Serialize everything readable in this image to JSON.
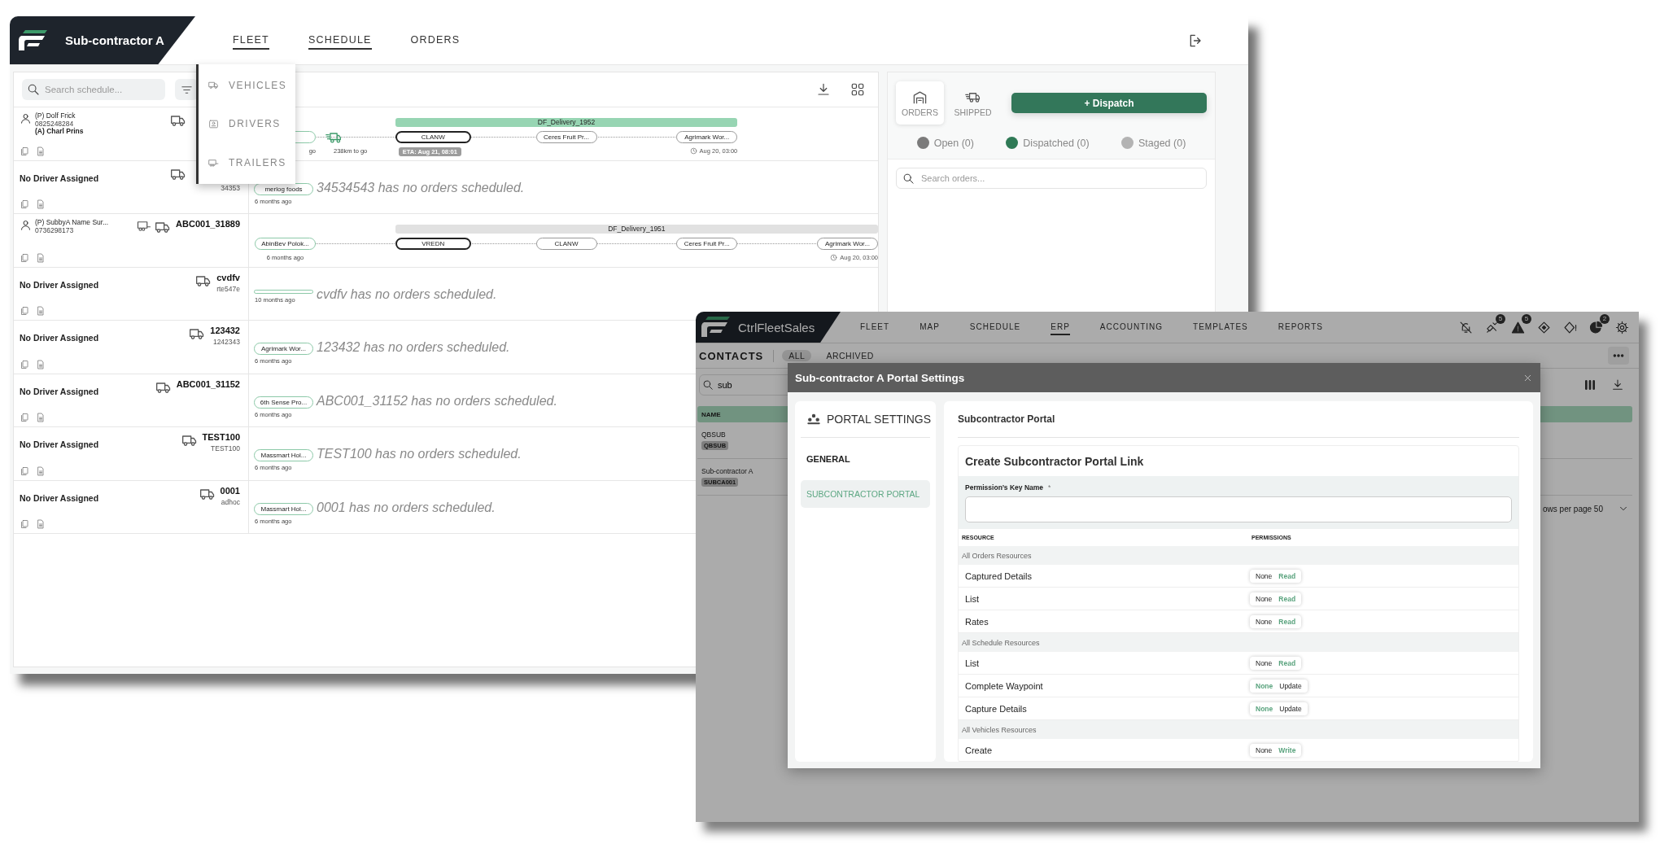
{
  "fleet_window": {
    "brand": "Sub-contractor A",
    "nav": [
      {
        "label": "FLEET",
        "selected": true
      },
      {
        "label": "SCHEDULE",
        "selected": true
      },
      {
        "label": "ORDERS",
        "selected": false
      }
    ],
    "fleet_menu": {
      "expanded": true,
      "items": [
        {
          "label": "VEHICLES",
          "kind": "vehicle"
        },
        {
          "label": "DRIVERS",
          "kind": "driver"
        },
        {
          "label": "TRAILERS",
          "kind": "trailer"
        }
      ]
    },
    "search": {
      "placeholder": "Search schedule..."
    },
    "rows": [
      {
        "driver": {
          "kind": "person",
          "lines": [
            "(P) Dolf Frick",
            "0825248284",
            "(A) Charl Prins"
          ]
        },
        "trailer": false,
        "timeline": {
          "kind": "trip",
          "trip": "DF_Delivery_1952",
          "active": true,
          "origin": {
            "time": "go"
          },
          "progress": "238km to go",
          "stops": [
            {
              "label": "CLANW",
              "current": true,
              "eta": "ETA: Aug 21, 08:01"
            },
            {
              "label": "Ceres Fruit Pr...",
              "current": false
            },
            {
              "label": "Agrimark Wor...",
              "current": false,
              "due": "Aug 20, 03:00"
            }
          ]
        }
      },
      {
        "driver": {
          "kind": "none",
          "label": "No Driver Assigned"
        },
        "trailer": false,
        "vehicle": {
          "reg": "34353"
        },
        "timeline": {
          "kind": "empty",
          "origin": {
            "label": "merlog foods",
            "time": "6 months ago"
          },
          "message": "34534543 has no orders scheduled."
        }
      },
      {
        "driver": {
          "kind": "person",
          "lines": [
            "(P) SubbyA Name Sur...",
            "0736298173"
          ]
        },
        "trailer": true,
        "vehicle": {
          "name": "ABC001_31889"
        },
        "timeline": {
          "kind": "trip",
          "trip": "DF_Delivery_1951",
          "active": false,
          "origin": {
            "label": "AbinBev Polok...",
            "time": "6 months ago"
          },
          "stops": [
            {
              "label": "VREDN",
              "current": true
            },
            {
              "label": "CLANW",
              "current": false
            },
            {
              "label": "Ceres Fruit Pr...",
              "current": false
            },
            {
              "label": "Agrimark Wor...",
              "current": false,
              "due": "Aug 20, 03:00"
            }
          ]
        }
      },
      {
        "driver": {
          "kind": "none",
          "label": "No Driver Assigned"
        },
        "trailer": false,
        "vehicle": {
          "name": "cvdfv",
          "reg": "rte547e"
        },
        "timeline": {
          "kind": "empty",
          "origin": {
            "time": "10 months ago"
          },
          "message": "cvdfv has no orders scheduled."
        }
      },
      {
        "driver": {
          "kind": "none",
          "label": "No Driver Assigned"
        },
        "trailer": false,
        "vehicle": {
          "name": "123432",
          "reg": "1242343"
        },
        "timeline": {
          "kind": "empty",
          "origin": {
            "label": "Agrimark Wor...",
            "time": "6 months ago"
          },
          "message": "123432 has no orders scheduled."
        }
      },
      {
        "driver": {
          "kind": "none",
          "label": "No Driver Assigned"
        },
        "trailer": false,
        "vehicle": {
          "name": "ABC001_31152"
        },
        "timeline": {
          "kind": "empty",
          "origin": {
            "label": "6th Sense Pro...",
            "time": "6 months ago"
          },
          "message": "ABC001_31152 has no orders scheduled."
        }
      },
      {
        "driver": {
          "kind": "none",
          "label": "No Driver Assigned"
        },
        "trailer": false,
        "vehicle": {
          "name": "TEST100",
          "reg": "TEST100"
        },
        "timeline": {
          "kind": "empty",
          "origin": {
            "label": "Massmart Hol...",
            "time": "6 months ago"
          },
          "message": "TEST100 has no orders scheduled."
        }
      },
      {
        "driver": {
          "kind": "none",
          "label": "No Driver Assigned"
        },
        "trailer": false,
        "vehicle": {
          "name": "0001",
          "reg": "adhoc"
        },
        "timeline": {
          "kind": "empty",
          "origin": {
            "label": "Massmart Hol...",
            "time": "6 months ago"
          },
          "message": "0001 has no orders scheduled."
        }
      }
    ],
    "orders_panel": {
      "tabs": [
        {
          "label": "ORDERS",
          "kind": "orders",
          "selected": true
        },
        {
          "label": "SHIPPED",
          "kind": "shipped",
          "selected": false
        }
      ],
      "dispatch_button": "+ Dispatch",
      "statuses": [
        {
          "label": "Open (0)",
          "color": "#7b7b7b"
        },
        {
          "label": "Dispatched (0)",
          "color": "#2f7a56"
        },
        {
          "label": "Staged (0)",
          "color": "#b3b3b3"
        }
      ],
      "search": {
        "placeholder": "Search orders..."
      }
    }
  },
  "erp_window": {
    "brand": "CtrlFleetSales",
    "nav": [
      {
        "label": "FLEET",
        "selected": false
      },
      {
        "label": "MAP",
        "selected": false
      },
      {
        "label": "SCHEDULE",
        "selected": false
      },
      {
        "label": "ERP",
        "selected": true
      },
      {
        "label": "ACCOUNTING",
        "selected": false
      },
      {
        "label": "TEMPLATES",
        "selected": false
      },
      {
        "label": "REPORTS",
        "selected": false
      }
    ],
    "alerts": [
      {
        "kind": "bell-off"
      },
      {
        "kind": "satellite",
        "count": "5"
      },
      {
        "kind": "warning",
        "count": "5"
      },
      {
        "kind": "diamond"
      },
      {
        "kind": "diamond-alert"
      },
      {
        "kind": "pie",
        "count": "2"
      },
      {
        "kind": "settings"
      }
    ],
    "page_title": "CONTACTS",
    "filters": [
      {
        "label": "ALL",
        "selected": true
      },
      {
        "label": "ARCHIVED",
        "selected": false
      }
    ],
    "search": {
      "value": "sub"
    },
    "table": {
      "columns": [
        "NAME"
      ],
      "rows": [
        {
          "name": "QBSUB",
          "code": "QBSUB"
        },
        {
          "name": "Sub-contractor A",
          "code": "SUBCA001"
        }
      ]
    },
    "pagination": "ows per page 50"
  },
  "portal_modal": {
    "title": "Sub-contractor A Portal Settings",
    "menu_title": "PORTAL SETTINGS",
    "menu": [
      {
        "label": "GENERAL",
        "selected": false
      },
      {
        "label": "SUBCONTRACTOR PORTAL",
        "selected": true
      }
    ],
    "section_title": "Subcontractor Portal",
    "form": {
      "title": "Create Subcontractor Portal Link",
      "field_label": "Permission’s Key Name",
      "required_mark": "*",
      "columns": [
        "RESOURCE",
        "PERMISSIONS"
      ],
      "groups": [
        {
          "name": "All Orders Resources",
          "rows": [
            {
              "resource": "Captured Details",
              "options": [
                {
                  "label": "None",
                  "selected": false
                },
                {
                  "label": "Read",
                  "selected": true
                }
              ]
            },
            {
              "resource": "List",
              "options": [
                {
                  "label": "None",
                  "selected": false
                },
                {
                  "label": "Read",
                  "selected": true
                }
              ]
            },
            {
              "resource": "Rates",
              "options": [
                {
                  "label": "None",
                  "selected": false
                },
                {
                  "label": "Read",
                  "selected": true
                }
              ]
            }
          ]
        },
        {
          "name": "All Schedule Resources",
          "rows": [
            {
              "resource": "List",
              "options": [
                {
                  "label": "None",
                  "selected": false
                },
                {
                  "label": "Read",
                  "selected": true
                }
              ]
            },
            {
              "resource": "Complete Waypoint",
              "options": [
                {
                  "label": "None",
                  "selected": true
                },
                {
                  "label": "Update",
                  "selected": false
                }
              ]
            },
            {
              "resource": "Capture Details",
              "options": [
                {
                  "label": "None",
                  "selected": true
                },
                {
                  "label": "Update",
                  "selected": false
                }
              ]
            }
          ]
        },
        {
          "name": "All Vehicles Resources",
          "rows": [
            {
              "resource": "Create",
              "options": [
                {
                  "label": "None",
                  "selected": false
                },
                {
                  "label": "Write",
                  "selected": true
                }
              ]
            }
          ]
        }
      ]
    }
  }
}
